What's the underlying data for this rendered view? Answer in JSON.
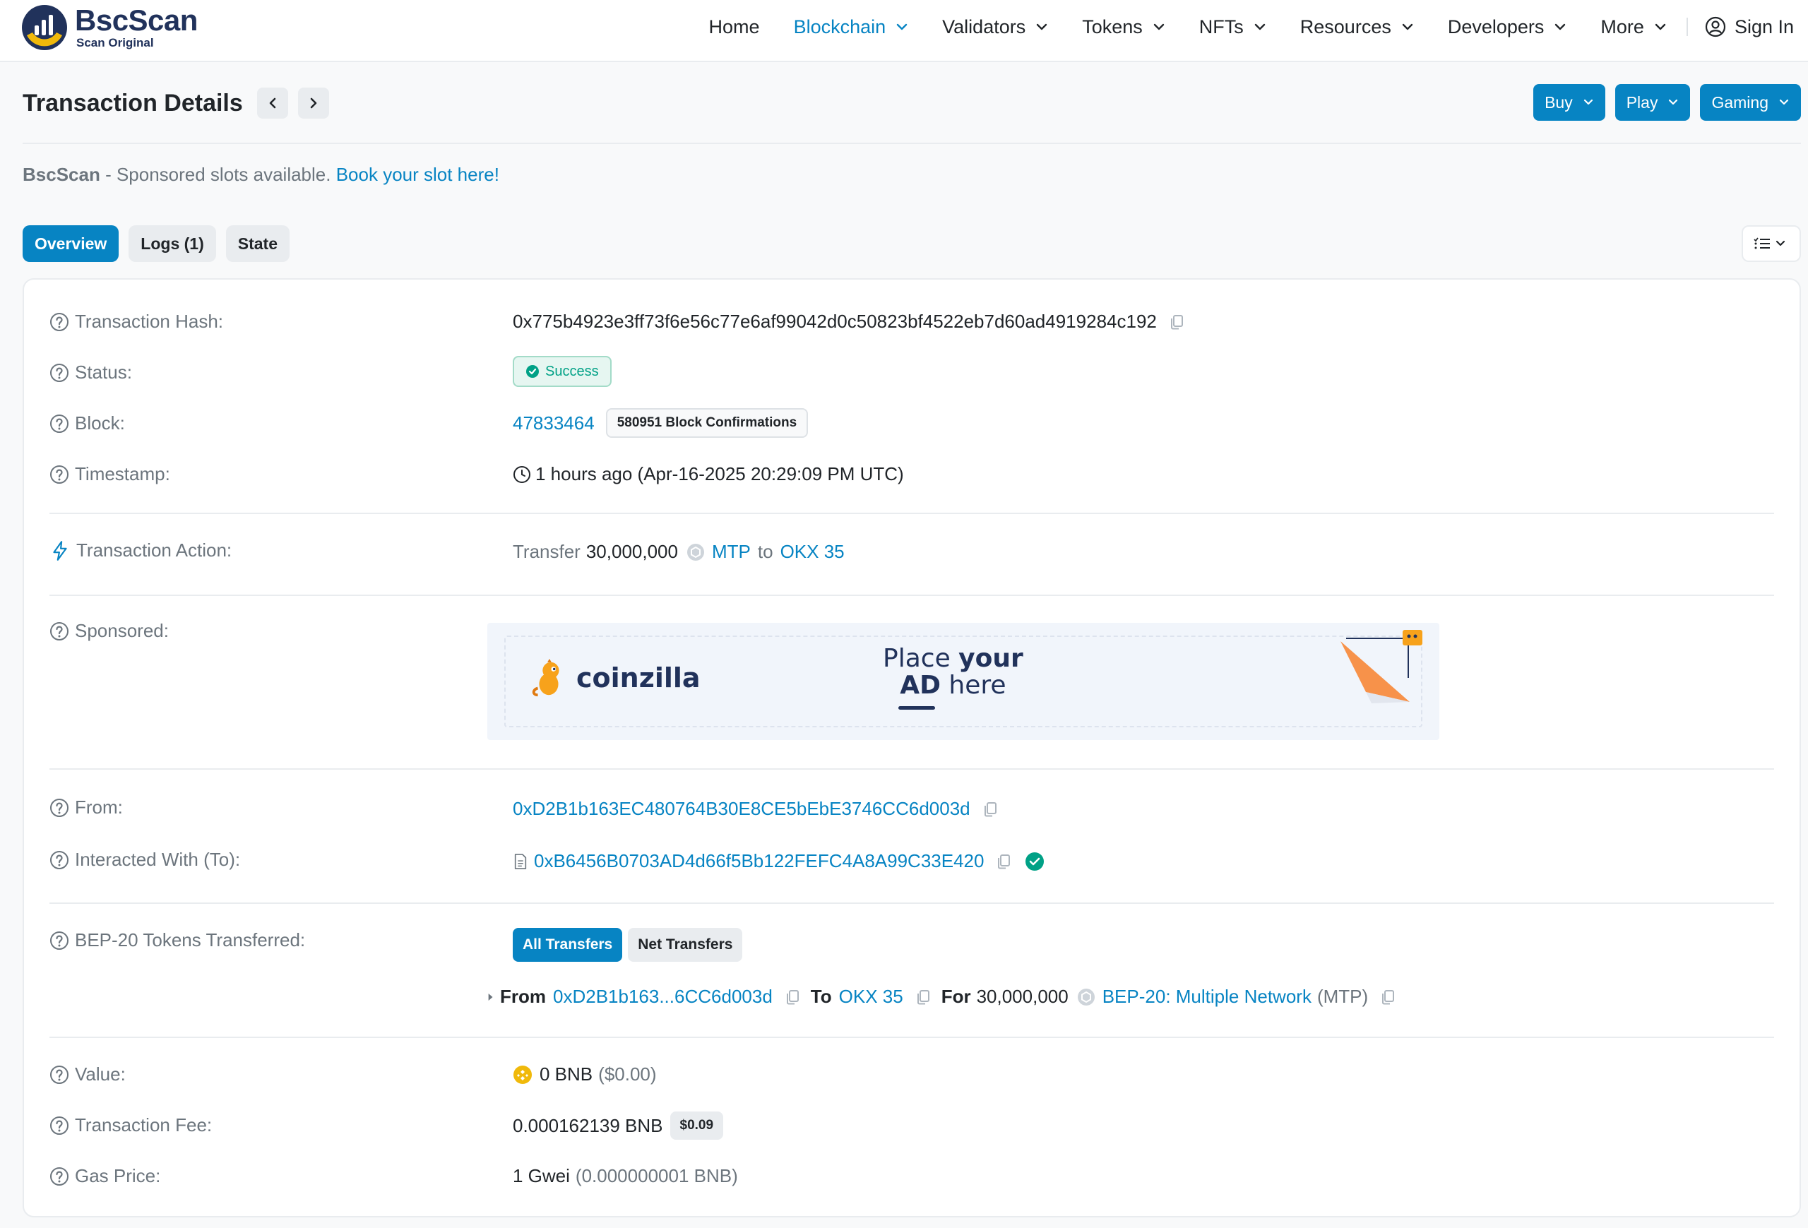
{
  "header": {
    "logo_name": "BscScan",
    "logo_sub": "Scan Original",
    "nav": [
      {
        "label": "Home",
        "dropdown": false
      },
      {
        "label": "Blockchain",
        "dropdown": true
      },
      {
        "label": "Validators",
        "dropdown": true
      },
      {
        "label": "Tokens",
        "dropdown": true
      },
      {
        "label": "NFTs",
        "dropdown": true
      },
      {
        "label": "Resources",
        "dropdown": true
      },
      {
        "label": "Developers",
        "dropdown": true
      },
      {
        "label": "More",
        "dropdown": true
      }
    ],
    "sign_in": "Sign In"
  },
  "page": {
    "title": "Transaction Details",
    "actions": [
      "Buy",
      "Play",
      "Gaming"
    ]
  },
  "sponsor_bar": {
    "brand": "BscScan",
    "text": " - Sponsored slots available. ",
    "link": "Book your slot here!"
  },
  "tabs": [
    "Overview",
    "Logs (1)",
    "State"
  ],
  "details": {
    "tx_hash_label": "Transaction Hash:",
    "tx_hash": "0x775b4923e3ff73f6e56c77e6af99042d0c50823bf4522eb7d60ad4919284c192",
    "status_label": "Status:",
    "status": "Success",
    "block_label": "Block:",
    "block": "47833464",
    "confirmations": "580951 Block Confirmations",
    "timestamp_label": "Timestamp:",
    "timestamp": "1 hours ago (Apr-16-2025 20:29:09 PM UTC)",
    "action_label": "Transaction Action:",
    "action": {
      "verb": "Transfer",
      "amount": "30,000,000",
      "token": "MTP",
      "to_word": "to",
      "recipient": "OKX 35"
    },
    "sponsored_label": "Sponsored:",
    "ad": {
      "brand": "coinzilla",
      "line1_a": "Place ",
      "line1_b": "your",
      "line2_a": "AD",
      "line2_b": " here"
    },
    "from_label": "From:",
    "from": "0xD2B1b163EC480764B30E8CE5bEbE3746CC6d003d",
    "to_label": "Interacted With (To):",
    "to": "0xB6456B0703AD4d66f5Bb122FEFC4A8A99C33E420",
    "tokens_label": "BEP-20 Tokens Transferred:",
    "token_tabs": [
      "All Transfers",
      "Net Transfers"
    ],
    "transfer": {
      "from_word": "From",
      "from_addr": "0xD2B1b163...6CC6d003d",
      "to_word": "To",
      "to_name": "OKX 35",
      "for_word": "For",
      "amount": "30,000,000",
      "token_name": "BEP-20: Multiple Network",
      "token_symbol": "(MTP)"
    },
    "value_label": "Value:",
    "value": "0 BNB",
    "value_usd": "($0.00)",
    "fee_label": "Transaction Fee:",
    "fee": "0.000162139 BNB",
    "fee_usd": "$0.09",
    "gas_label": "Gas Price:",
    "gas": "1 Gwei",
    "gas_bnb": "(0.000000001 BNB)"
  },
  "colors": {
    "primary": "#0784c3",
    "success": "#00a186",
    "bnb_yellow": "#f0b90b",
    "ad_orange": "#f7924a"
  },
  "icons": [
    "help-circle-icon",
    "lightning-icon",
    "copy-icon",
    "clock-icon",
    "check-circle-icon",
    "contract-file-icon",
    "chevron-down-icon",
    "user-circle-icon"
  ]
}
